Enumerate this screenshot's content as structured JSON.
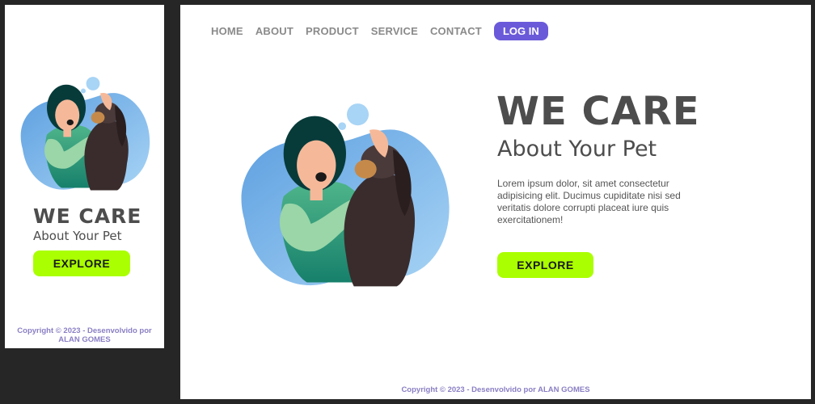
{
  "nav": {
    "items": [
      "HOME",
      "ABOUT",
      "PRODUCT",
      "SERVICE",
      "CONTACT"
    ],
    "login_label": "LOG IN"
  },
  "hero": {
    "title": "WE CARE",
    "subtitle": "About Your Pet",
    "body": "Lorem ipsum dolor, sit amet consectetur adipisicing elit. Ducimus cupiditate nisi sed veritatis dolore corrupti placeat iure quis exercitationem!",
    "cta_label": "EXPLORE"
  },
  "footer": {
    "text": "Copyright © 2023 - Desenvolvido por ALAN GOMES",
    "text_line1": "Copyright © 2023 - Desenvolvido por",
    "text_line2": "ALAN GOMES"
  },
  "colors": {
    "accent": "#6a5ad9",
    "cta": "#aaff00",
    "blob": "#7fb7e8",
    "footer": "#8a7fc4"
  }
}
